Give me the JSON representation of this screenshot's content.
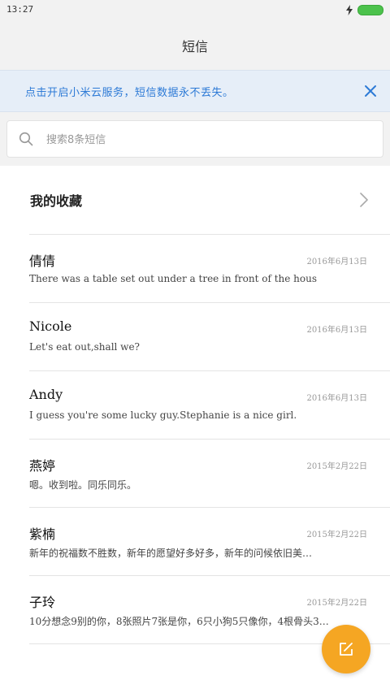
{
  "status_bar": {
    "time": "13:27",
    "battery_color": "#4cc24c"
  },
  "header": {
    "title": "短信"
  },
  "banner": {
    "text": "点击开启小米云服务，短信数据永不丢失。",
    "close_icon": "close-icon"
  },
  "search": {
    "placeholder": "搜索8条短信",
    "icon": "search-icon"
  },
  "favorites": {
    "label": "我的收藏",
    "icon": "chevron-right-icon"
  },
  "messages": [
    {
      "name": "倩倩",
      "date": "2016年6月13日",
      "preview": "There was a table set out under a tree in front of the hous"
    },
    {
      "name": "Nicole",
      "date": "2016年6月13日",
      "preview": "Let's eat out,shall we?"
    },
    {
      "name": "Andy",
      "date": "2016年6月13日",
      "preview": "I guess you're some lucky guy.Stephanie is a nice girl."
    },
    {
      "name": "燕婷",
      "date": "2015年2月22日",
      "preview": "嗯。收到啦。同乐同乐。"
    },
    {
      "name": "紫楠",
      "date": "2015年2月22日",
      "preview": "新年的祝福数不胜数，新年的愿望好多好多，新年的问候依旧美…"
    },
    {
      "name": "子玲",
      "date": "2015年2月22日",
      "preview": "10分想念9别的你，8张照片7张是你，6只小狗5只像你，4根骨头3…"
    }
  ],
  "compose": {
    "icon": "compose-icon",
    "color": "#f5a623"
  },
  "colors": {
    "accent_blue": "#2d7ad6",
    "banner_bg": "#e6eef8",
    "header_bg": "#f2f2f2"
  }
}
